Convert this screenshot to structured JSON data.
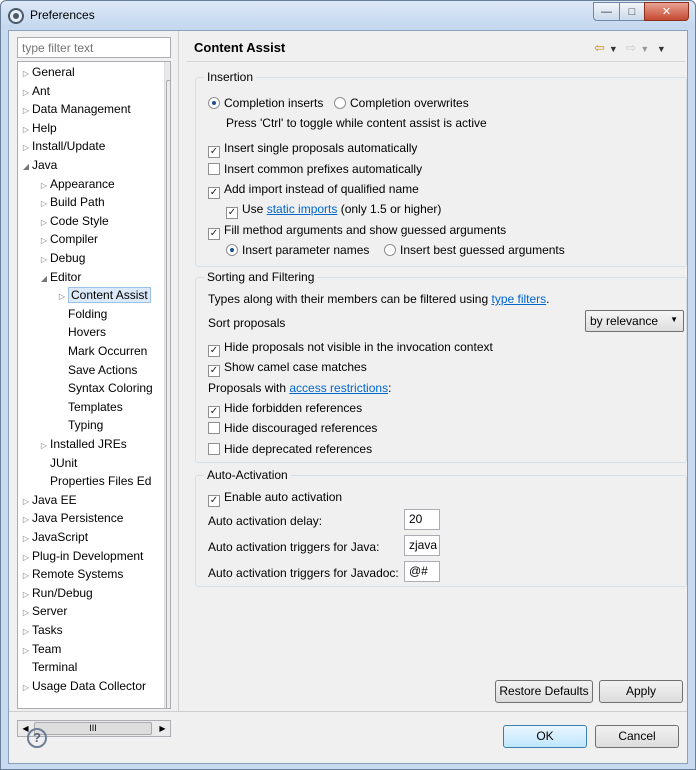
{
  "window": {
    "title": "Preferences"
  },
  "filter": {
    "placeholder": "type filter text"
  },
  "tree": {
    "items": [
      {
        "label": "General",
        "depth": 0,
        "toggle": "▷"
      },
      {
        "label": "Ant",
        "depth": 0,
        "toggle": "▷"
      },
      {
        "label": "Data Management",
        "depth": 0,
        "toggle": "▷"
      },
      {
        "label": "Help",
        "depth": 0,
        "toggle": "▷"
      },
      {
        "label": "Install/Update",
        "depth": 0,
        "toggle": "▷"
      },
      {
        "label": "Java",
        "depth": 0,
        "toggle": "◢"
      },
      {
        "label": "Appearance",
        "depth": 1,
        "toggle": "▷"
      },
      {
        "label": "Build Path",
        "depth": 1,
        "toggle": "▷"
      },
      {
        "label": "Code Style",
        "depth": 1,
        "toggle": "▷"
      },
      {
        "label": "Compiler",
        "depth": 1,
        "toggle": "▷"
      },
      {
        "label": "Debug",
        "depth": 1,
        "toggle": "▷"
      },
      {
        "label": "Editor",
        "depth": 1,
        "toggle": "◢"
      },
      {
        "label": "Content Assist",
        "depth": 2,
        "toggle": "▷",
        "selected": true
      },
      {
        "label": "Folding",
        "depth": 2,
        "toggle": ""
      },
      {
        "label": "Hovers",
        "depth": 2,
        "toggle": ""
      },
      {
        "label": "Mark Occurren",
        "depth": 2,
        "toggle": ""
      },
      {
        "label": "Save Actions",
        "depth": 2,
        "toggle": ""
      },
      {
        "label": "Syntax Coloring",
        "depth": 2,
        "toggle": ""
      },
      {
        "label": "Templates",
        "depth": 2,
        "toggle": ""
      },
      {
        "label": "Typing",
        "depth": 2,
        "toggle": ""
      },
      {
        "label": "Installed JREs",
        "depth": 1,
        "toggle": "▷"
      },
      {
        "label": "JUnit",
        "depth": 1,
        "toggle": ""
      },
      {
        "label": "Properties Files Ed",
        "depth": 1,
        "toggle": ""
      },
      {
        "label": "Java EE",
        "depth": 0,
        "toggle": "▷"
      },
      {
        "label": "Java Persistence",
        "depth": 0,
        "toggle": "▷"
      },
      {
        "label": "JavaScript",
        "depth": 0,
        "toggle": "▷"
      },
      {
        "label": "Plug-in Development",
        "depth": 0,
        "toggle": "▷"
      },
      {
        "label": "Remote Systems",
        "depth": 0,
        "toggle": "▷"
      },
      {
        "label": "Run/Debug",
        "depth": 0,
        "toggle": "▷"
      },
      {
        "label": "Server",
        "depth": 0,
        "toggle": "▷"
      },
      {
        "label": "Tasks",
        "depth": 0,
        "toggle": "▷"
      },
      {
        "label": "Team",
        "depth": 0,
        "toggle": "▷"
      },
      {
        "label": "Terminal",
        "depth": 0,
        "toggle": ""
      },
      {
        "label": "Usage Data Collector",
        "depth": 0,
        "toggle": "▷"
      }
    ]
  },
  "page": {
    "title": "Content Assist",
    "insertion": {
      "legend": "Insertion",
      "completion_inserts": "Completion inserts",
      "completion_overwrites": "Completion overwrites",
      "toggle_hint": "Press 'Ctrl' to toggle while content assist is active",
      "insert_single": "Insert single proposals automatically",
      "insert_common": "Insert common prefixes automatically",
      "add_import": "Add import instead of qualified name",
      "use_static_prefix": "Use ",
      "static_imports_link": "static imports",
      "use_static_suffix": " (only 1.5 or higher)",
      "fill_method": "Fill method arguments and show guessed arguments",
      "insert_param_names": "Insert parameter names",
      "insert_best_guessed": "Insert best guessed arguments"
    },
    "sorting": {
      "legend": "Sorting and Filtering",
      "types_text": "Types along with their members can be filtered using ",
      "type_filters_link": "type filters",
      "types_suffix": ".",
      "sort_label": "Sort proposals",
      "sort_value": "by relevance",
      "hide_not_visible": "Hide proposals not visible in the invocation context",
      "camel_case": "Show camel case matches",
      "proposals_with": "Proposals with ",
      "access_link": "access restrictions",
      "proposals_suffix": ":",
      "hide_forbidden": "Hide forbidden references",
      "hide_discouraged": "Hide discouraged references",
      "hide_deprecated": "Hide deprecated references"
    },
    "auto": {
      "legend": "Auto-Activation",
      "enable": "Enable auto activation",
      "delay_label": "Auto activation delay:",
      "delay_value": "20",
      "java_label": "Auto activation triggers for Java:",
      "java_value": "zjava",
      "javadoc_label": "Auto activation triggers for Javadoc:",
      "javadoc_value": "@#"
    },
    "restore_defaults": "Restore Defaults",
    "apply": "Apply"
  },
  "footer": {
    "ok": "OK",
    "cancel": "Cancel"
  },
  "glyphs": {
    "check": "✓",
    "scroll_thumb_h": "III"
  }
}
